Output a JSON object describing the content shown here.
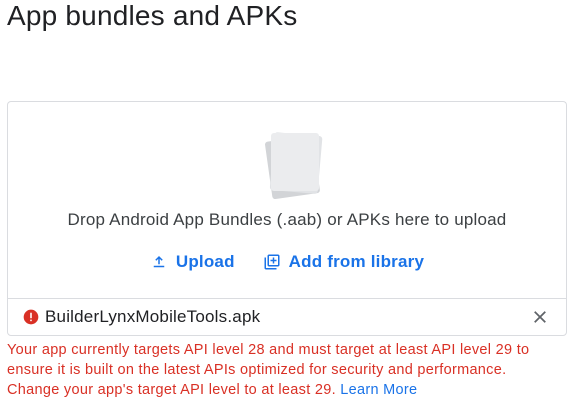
{
  "page": {
    "title": "App bundles and APKs"
  },
  "drop_zone": {
    "instructions": "Drop Android App Bundles (.aab) or APKs here to upload",
    "upload_label": "Upload",
    "add_from_library_label": "Add from library"
  },
  "file": {
    "name": "BuilderLynxMobileTools.apk",
    "status_icon": "error-icon",
    "remove_icon": "close-icon"
  },
  "error": {
    "message": "Your app currently targets API level 28 and must target at least API level 29 to ensure it is built on the latest APIs optimized for security and performance. Change your app's target API level to at least 29. ",
    "link_label": "Learn More"
  },
  "colors": {
    "accent": "#1a73e8",
    "error": "#d93025",
    "border": "#dadce0",
    "text": "#202124"
  }
}
